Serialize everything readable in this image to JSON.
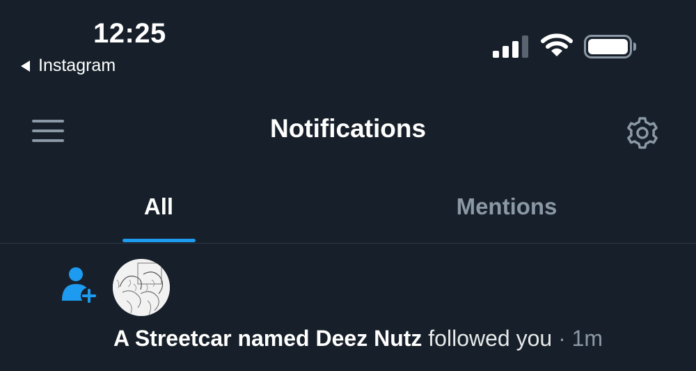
{
  "status_bar": {
    "time": "12:25",
    "back_app": "Instagram"
  },
  "header": {
    "title": "Notifications",
    "menu_icon": "hamburger-menu-icon",
    "settings_icon": "gear-icon"
  },
  "tabs": [
    {
      "label": "All",
      "selected": true
    },
    {
      "label": "Mentions",
      "selected": false
    }
  ],
  "notifications": [
    {
      "type_icon": "person-add-icon",
      "user": "A Streetcar named Deez Nutz",
      "action": "followed you",
      "separator": " · ",
      "time": "1m"
    }
  ],
  "colors": {
    "background": "#17202a",
    "accent": "#1d9bf0",
    "muted_text": "#8b98a5"
  }
}
